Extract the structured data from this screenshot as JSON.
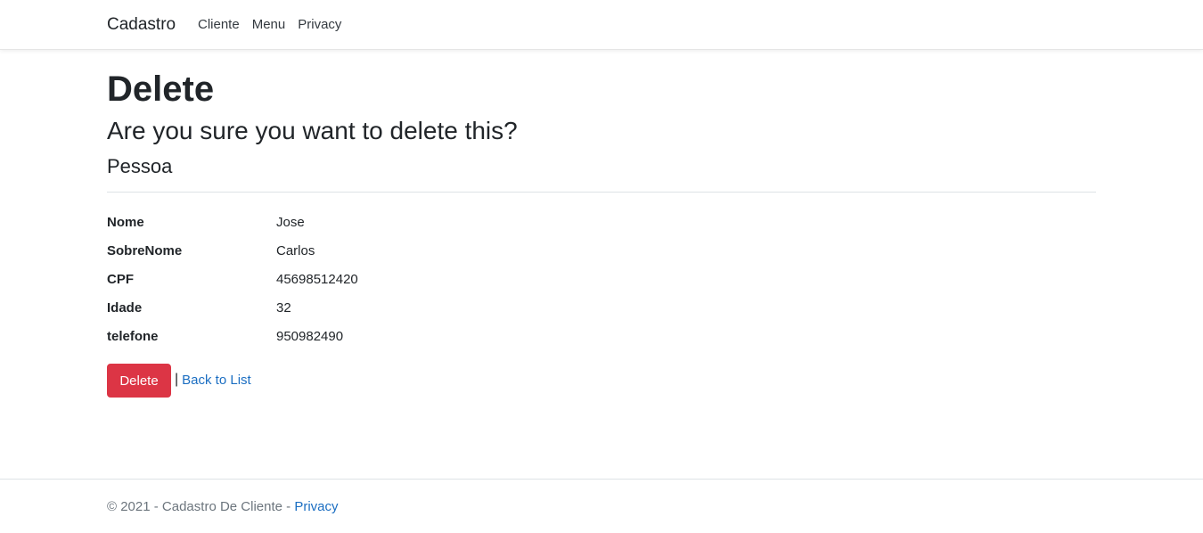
{
  "navbar": {
    "brand": "Cadastro",
    "links": [
      "Cliente",
      "Menu",
      "Privacy"
    ]
  },
  "page": {
    "title": "Delete",
    "question": "Are you sure you want to delete this?",
    "entity": "Pessoa"
  },
  "details": [
    {
      "label": "Nome",
      "value": "Jose"
    },
    {
      "label": "SobreNome",
      "value": "Carlos"
    },
    {
      "label": "CPF",
      "value": "45698512420"
    },
    {
      "label": "Idade",
      "value": "32"
    },
    {
      "label": "telefone",
      "value": "950982490"
    }
  ],
  "actions": {
    "delete_label": "Delete",
    "separator": "|",
    "back_label": "Back to List"
  },
  "footer": {
    "text": "© 2021 - Cadastro De Cliente - ",
    "privacy_label": "Privacy"
  },
  "colors": {
    "danger": "#dc3545",
    "link": "#1b6ec2",
    "muted": "#6c757d"
  }
}
